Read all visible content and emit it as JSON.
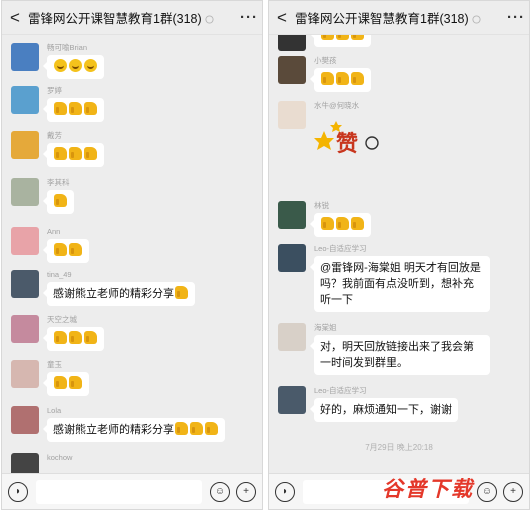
{
  "left": {
    "header": {
      "title": "雷锋网公开课智慧教育1群(318)",
      "back_label": "<",
      "more_label": "···"
    },
    "messages": [
      {
        "name": "畅可喻Brian",
        "emoji": [
          "sweat",
          "sweat",
          "sweat"
        ],
        "text": ""
      },
      {
        "name": "罗婷",
        "emoji": [
          "thumb",
          "thumb",
          "thumb"
        ],
        "text": ""
      },
      {
        "name": "戴芳",
        "emoji": [
          "thumb",
          "thumb",
          "thumb"
        ],
        "text": ""
      },
      {
        "name": "李其科",
        "emoji": [
          "thumb"
        ],
        "text": ""
      },
      {
        "name": "Ann",
        "emoji": [
          "thumb",
          "thumb"
        ],
        "text": ""
      },
      {
        "name": "tina_49",
        "emoji": [
          "thumb"
        ],
        "text": "感谢熊立老师的精彩分享"
      },
      {
        "name": "天空之城",
        "emoji": [
          "thumb",
          "thumb",
          "thumb"
        ],
        "text": ""
      },
      {
        "name": "童玉",
        "emoji": [
          "thumb",
          "thumb"
        ],
        "text": ""
      },
      {
        "name": "Lola",
        "emoji": [
          "thumb",
          "thumb",
          "thumb"
        ],
        "text": "感谢熊立老师的精彩分享"
      },
      {
        "name": "kochow",
        "emoji": [],
        "text": ""
      }
    ]
  },
  "right": {
    "header": {
      "title": "雷锋网公开课智慧教育1群(318)",
      "back_label": "<",
      "more_label": "···"
    },
    "messages": [
      {
        "name": "",
        "emoji": [
          "thumb",
          "thumb",
          "thumb"
        ],
        "text": ""
      },
      {
        "name": "小樊孩",
        "emoji": [
          "thumb",
          "thumb",
          "thumb"
        ],
        "text": ""
      },
      {
        "name": "水牛@何晓水",
        "emoji": [],
        "text": "",
        "sticker": "赞"
      },
      {
        "name": "林锐",
        "emoji": [
          "thumb",
          "thumb",
          "thumb"
        ],
        "text": ""
      },
      {
        "name": "Leo-自适应学习",
        "emoji": [],
        "text": "@雷锋网-海棠姐 明天才有回放是吗？我前面有点没听到，想补充听一下"
      },
      {
        "name": "海棠姐",
        "emoji": [],
        "text": "对，明天回放链接出来了我会第一时间发到群里。"
      },
      {
        "name": "Leo-自适应学习",
        "emoji": [],
        "text": "好的，麻烦通知一下，谢谢"
      }
    ],
    "timestamp": "7月29日 晚上20:18"
  },
  "watermark": "谷普下载",
  "colors": {
    "bg": "#ededed",
    "bubble": "#ffffff",
    "emoji": "#f4c21c",
    "watermark": "#e4382a"
  }
}
